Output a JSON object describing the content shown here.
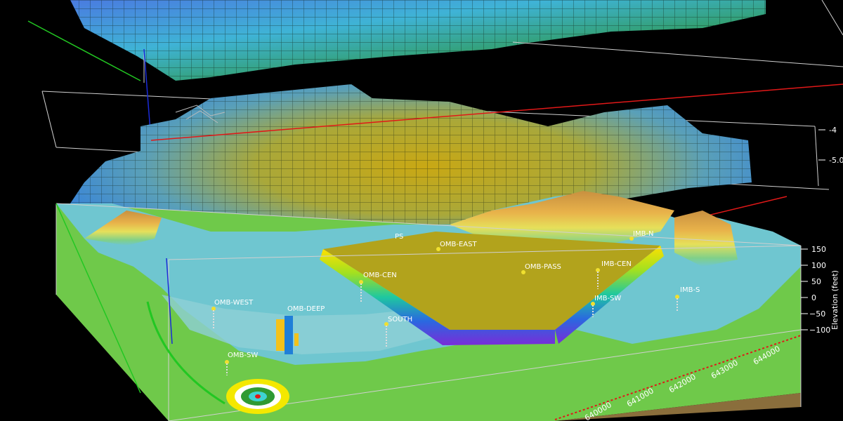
{
  "elevation_axis": {
    "title": "Elevation (feet)",
    "ticks": [
      "150",
      "100",
      "50",
      "0",
      "−50",
      "−100"
    ]
  },
  "easting_axis": {
    "ticks": [
      "640000",
      "641000",
      "642000",
      "643000",
      "644000"
    ]
  },
  "upper_axis": {
    "ticks": [
      "-4",
      "-5.0"
    ]
  },
  "wells": [
    {
      "name": "OMB-WEST"
    },
    {
      "name": "OMB-DEEP"
    },
    {
      "name": "OMB-SW"
    },
    {
      "name": "OMB-CEN"
    },
    {
      "name": "SOUTH"
    },
    {
      "name": "OMB-EAST"
    },
    {
      "name": "OMB-PASS"
    },
    {
      "name": "IMB-CEN"
    },
    {
      "name": "IMB-SW"
    },
    {
      "name": "IMB-S"
    },
    {
      "name": "IMB-N"
    },
    {
      "name": "PS"
    }
  ],
  "colors": {
    "background": "#000000",
    "terrain_green": "#6fc94a",
    "water_cyan": "#6fc6d0",
    "grid_top": "#2f8f6a",
    "grid_mid": "#b3a425",
    "box_line": "#d0d0d0",
    "red_line": "#e01818",
    "blue_line": "#1a2bd8",
    "green_line": "#22c722"
  }
}
